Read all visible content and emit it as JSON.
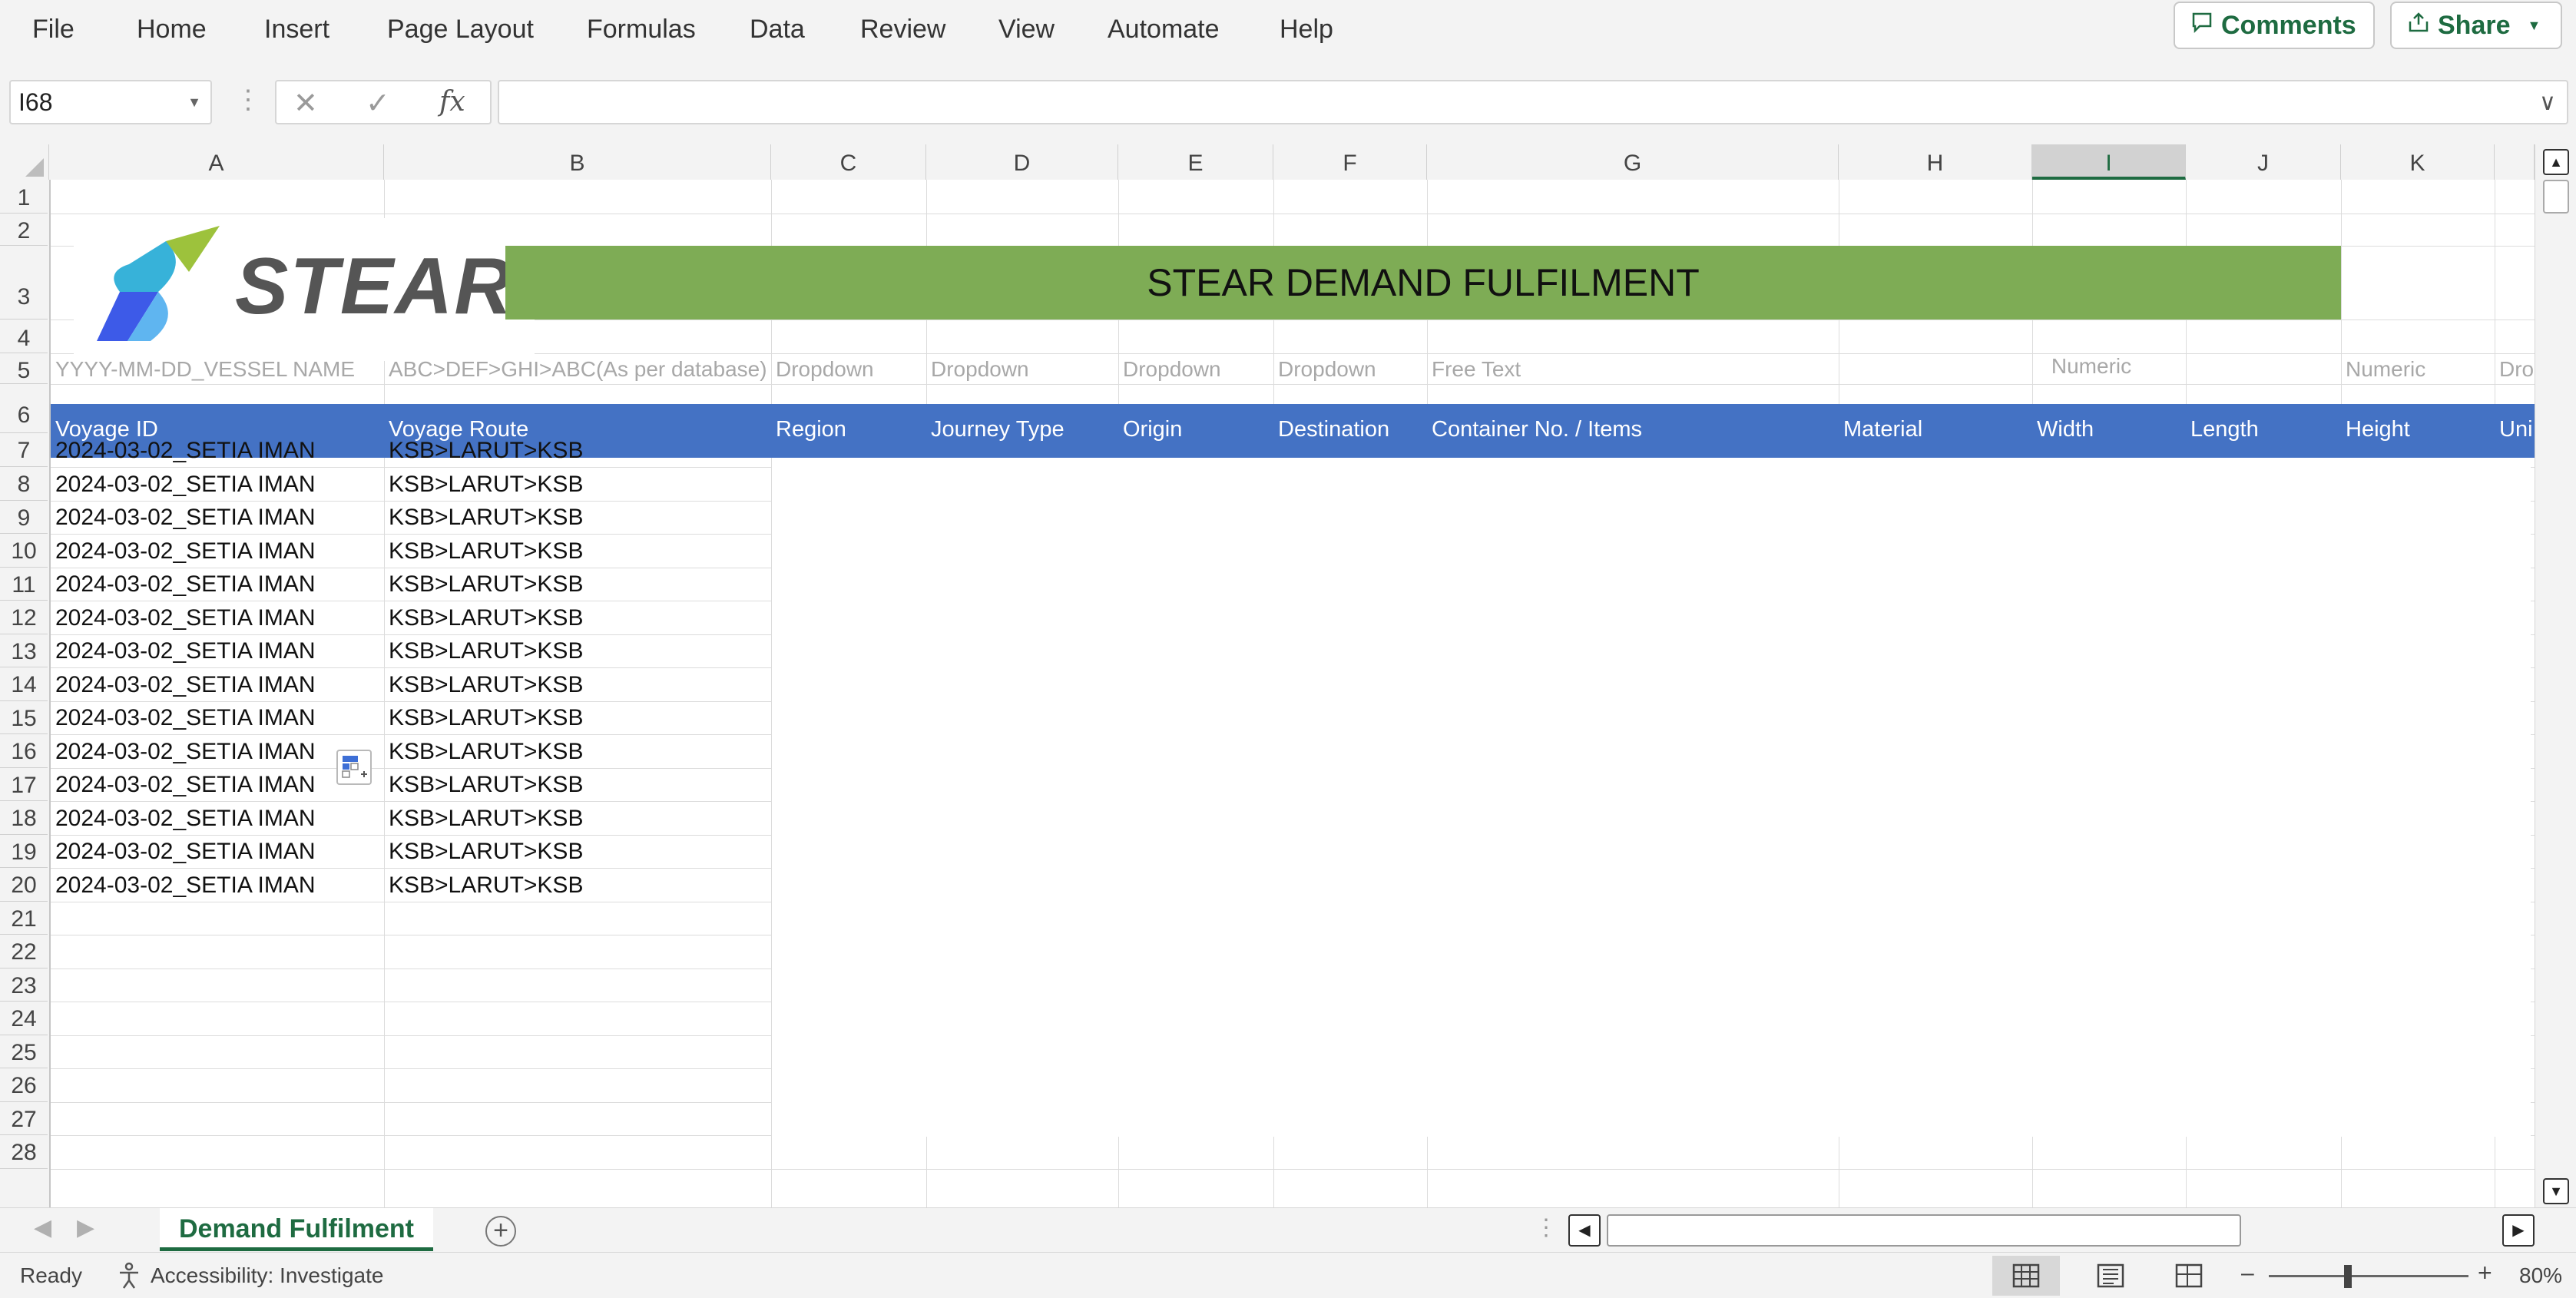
{
  "menu": {
    "items": [
      "File",
      "Home",
      "Insert",
      "Page Layout",
      "Formulas",
      "Data",
      "Review",
      "View",
      "Automate",
      "Help"
    ],
    "comments_label": "Comments",
    "share_label": "Share"
  },
  "formula_bar": {
    "name_box": "I68",
    "formula": ""
  },
  "columns": [
    "A",
    "B",
    "C",
    "D",
    "E",
    "F",
    "G",
    "H",
    "I",
    "J",
    "K"
  ],
  "selected_column": "I",
  "rows": [
    "1",
    "2",
    "3",
    "4",
    "5",
    "6",
    "7",
    "8",
    "9",
    "10",
    "11",
    "12",
    "13",
    "14",
    "15",
    "16",
    "17",
    "18",
    "19",
    "20",
    "21",
    "22",
    "23",
    "24",
    "25",
    "26",
    "27",
    "28"
  ],
  "sheet": {
    "logo_text": "STEAR",
    "title": "STEAR DEMAND FULFILMENT",
    "hints": {
      "a": "YYYY-MM-DD_VESSEL NAME",
      "b": "ABC>DEF>GHI>ABC(As per database)",
      "c": "Dropdown",
      "d": "Dropdown",
      "e": "Dropdown",
      "f": "Dropdown",
      "g": "Free Text",
      "i": "Numeric",
      "k": "Numeric",
      "l": "Dro"
    },
    "headers": {
      "a": "Voyage ID",
      "b": "Voyage Route",
      "c": "Region",
      "d": "Journey Type",
      "e": "Origin",
      "f": "Destination",
      "g": "Container No. / Items",
      "h": "Material",
      "i": "Width",
      "j": "Length",
      "k": "Height",
      "l": "Uni"
    },
    "data_rows": [
      [
        "2024-03-02_SETIA IMAN",
        "KSB>LARUT>KSB"
      ],
      [
        "2024-03-02_SETIA IMAN",
        "KSB>LARUT>KSB"
      ],
      [
        "2024-03-02_SETIA IMAN",
        "KSB>LARUT>KSB"
      ],
      [
        "2024-03-02_SETIA IMAN",
        "KSB>LARUT>KSB"
      ],
      [
        "2024-03-02_SETIA IMAN",
        "KSB>LARUT>KSB"
      ],
      [
        "2024-03-02_SETIA IMAN",
        "KSB>LARUT>KSB"
      ],
      [
        "2024-03-02_SETIA IMAN",
        "KSB>LARUT>KSB"
      ],
      [
        "2024-03-02_SETIA IMAN",
        "KSB>LARUT>KSB"
      ],
      [
        "2024-03-02_SETIA IMAN",
        "KSB>LARUT>KSB"
      ],
      [
        "2024-03-02_SETIA IMAN",
        "KSB>LARUT>KSB"
      ],
      [
        "2024-03-02_SETIA IMAN",
        "KSB>LARUT>KSB"
      ],
      [
        "2024-03-02_SETIA IMAN",
        "KSB>LARUT>KSB"
      ],
      [
        "2024-03-02_SETIA IMAN",
        "KSB>LARUT>KSB"
      ],
      [
        "2024-03-02_SETIA IMAN",
        "KSB>LARUT>KSB"
      ]
    ]
  },
  "tabs": {
    "active": "Demand Fulfilment"
  },
  "status": {
    "ready": "Ready",
    "accessibility": "Accessibility: Investigate",
    "zoom": "80%"
  },
  "colors": {
    "header_band": "#4472c4",
    "title_band": "#7eac55",
    "excel_green": "#1e6b41"
  }
}
